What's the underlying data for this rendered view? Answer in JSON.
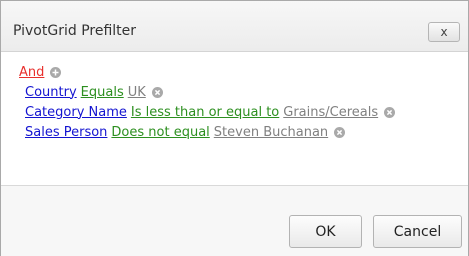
{
  "window": {
    "title": "PivotGrid Prefilter",
    "close_glyph": "x"
  },
  "filter": {
    "group": {
      "operator": "And",
      "add_icon": "plus-circle-icon"
    },
    "conditions": [
      {
        "field": "Country",
        "operator": "Equals",
        "value": "UK",
        "remove_icon": "remove-circle-icon"
      },
      {
        "field": "Category Name",
        "operator": "Is less than or equal to",
        "value": "Grains/Cereals",
        "remove_icon": "remove-circle-icon"
      },
      {
        "field": "Sales Person",
        "operator": "Does not equal",
        "value": "Steven Buchanan",
        "remove_icon": "remove-circle-icon"
      }
    ]
  },
  "buttons": {
    "ok": "OK",
    "cancel": "Cancel"
  },
  "colors": {
    "group": "#e8302d",
    "field": "#1414d0",
    "operator": "#2c8f1f",
    "value": "#808080"
  }
}
